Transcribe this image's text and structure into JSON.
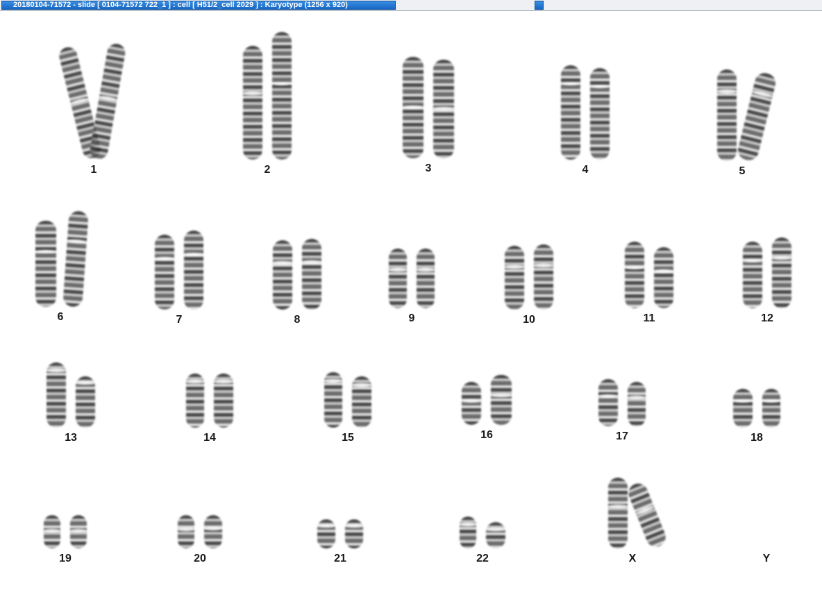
{
  "window": {
    "title": "20180104-71572 - slide [ 0104-71572 722_1 ] : cell [ H51/2_cell 2029 ] : Karyotype  (1256 x 920)"
  },
  "karyotype": {
    "labels": {
      "c1": "1",
      "c2": "2",
      "c3": "3",
      "c4": "4",
      "c5": "5",
      "c6": "6",
      "c7": "7",
      "c8": "8",
      "c9": "9",
      "c10": "10",
      "c11": "11",
      "c12": "12",
      "c13": "13",
      "c14": "14",
      "c15": "15",
      "c16": "16",
      "c17": "17",
      "c18": "18",
      "c19": "19",
      "c20": "20",
      "c21": "21",
      "c22": "22",
      "cX": "X",
      "cY": "Y"
    }
  }
}
